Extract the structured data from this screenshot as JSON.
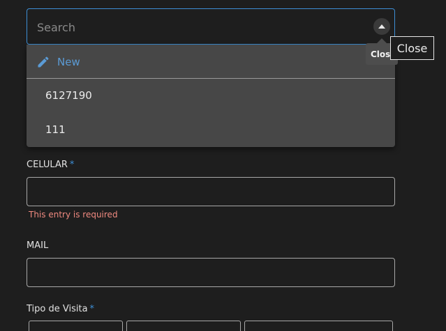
{
  "search": {
    "placeholder": "Search",
    "value": ""
  },
  "tooltips": {
    "small": "Close",
    "large": "Close"
  },
  "dropdown": {
    "new_label": "New",
    "options": [
      {
        "label": "6127190"
      },
      {
        "label": "111"
      }
    ]
  },
  "form": {
    "celular": {
      "label": "CELULAR",
      "required_mark": "*",
      "value": "",
      "error": "This entry is required"
    },
    "mail": {
      "label": "MAIL",
      "value": ""
    },
    "tipo_visita": {
      "label": "Tipo de Visita",
      "required_mark": "*"
    }
  },
  "icons": {
    "toggle": "chevron-up-icon",
    "new": "pencil-icon"
  },
  "colors": {
    "accent": "#3d8fd6",
    "error": "#f08a80",
    "background": "#1e1e1e",
    "dropdown": "#474747"
  }
}
